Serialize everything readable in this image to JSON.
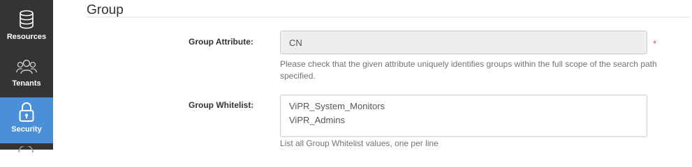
{
  "sidebar": {
    "items": [
      {
        "label": "Resources",
        "icon": "database-icon",
        "active": false
      },
      {
        "label": "Tenants",
        "icon": "users-icon",
        "active": false
      },
      {
        "label": "Security",
        "icon": "lock-icon",
        "active": true
      }
    ]
  },
  "section": {
    "title": "Group"
  },
  "form": {
    "group_attribute": {
      "label": "Group Attribute:",
      "value": "CN",
      "required_mark": "*",
      "help": "Please check that the given attribute uniquely identifies groups within the full scope of the search path specified."
    },
    "group_whitelist": {
      "label": "Group Whitelist:",
      "value": "ViPR_System_Monitors\nViPR_Admins",
      "help": "List all Group Whitelist values, one per line"
    }
  },
  "colors": {
    "sidebar_bg": "#333435",
    "active_nav": "#4a90d9",
    "required": "#d9534f"
  }
}
